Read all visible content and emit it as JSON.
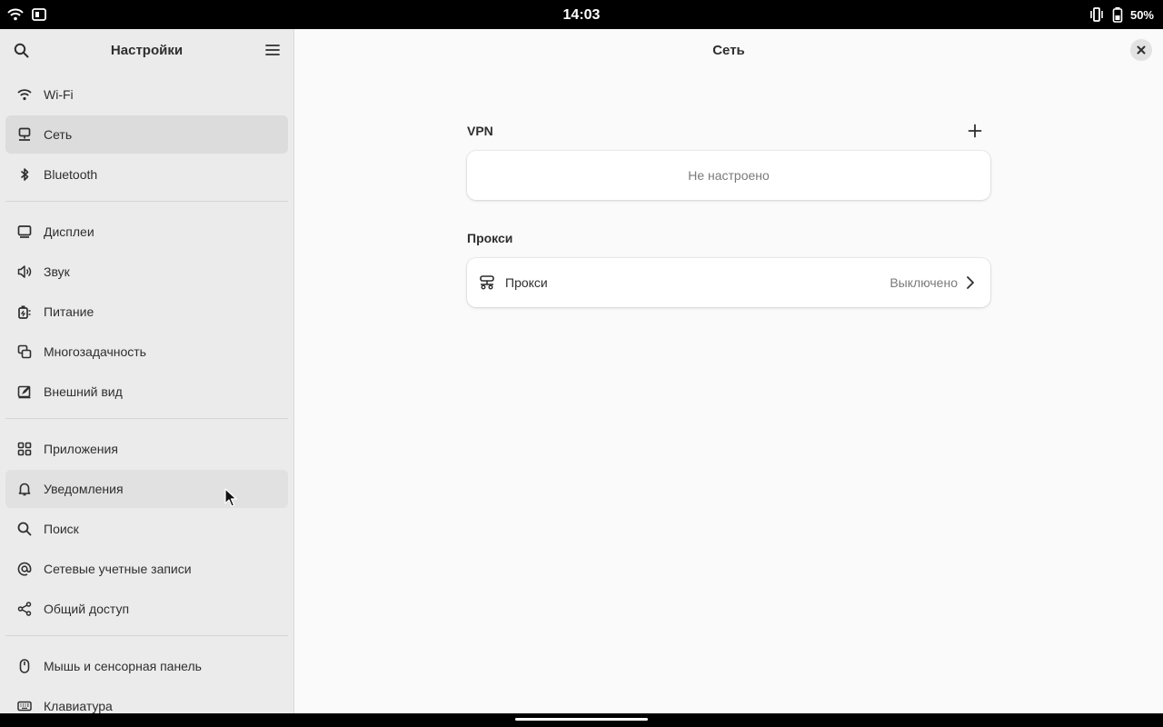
{
  "statusbar": {
    "clock": "14:03",
    "battery_percent": "50%",
    "icons": [
      "wifi-icon",
      "screen-rotate-icon",
      "vibrate-icon",
      "battery-icon"
    ]
  },
  "sidebar": {
    "title": "Настройки",
    "groups": [
      [
        {
          "label": "Wi-Fi",
          "icon": "wifi-icon"
        },
        {
          "label": "Сеть",
          "icon": "network-icon",
          "selected": true
        },
        {
          "label": "Bluetooth",
          "icon": "bluetooth-icon"
        }
      ],
      [
        {
          "label": "Дисплеи",
          "icon": "display-icon"
        },
        {
          "label": "Звук",
          "icon": "sound-icon"
        },
        {
          "label": "Питание",
          "icon": "power-icon"
        },
        {
          "label": "Многозадачность",
          "icon": "multitasking-icon"
        },
        {
          "label": "Внешний вид",
          "icon": "appearance-icon"
        }
      ],
      [
        {
          "label": "Приложения",
          "icon": "apps-icon"
        },
        {
          "label": "Уведомления",
          "icon": "bell-icon",
          "hover": true
        },
        {
          "label": "Поиск",
          "icon": "search-icon"
        },
        {
          "label": "Сетевые учетные записи",
          "icon": "at-icon"
        },
        {
          "label": "Общий доступ",
          "icon": "share-icon"
        }
      ],
      [
        {
          "label": "Мышь и сенсорная панель",
          "icon": "mouse-icon"
        },
        {
          "label": "Клавиатура",
          "icon": "keyboard-icon"
        }
      ]
    ]
  },
  "content": {
    "title": "Сеть",
    "vpn": {
      "title": "VPN",
      "empty_text": "Не настроено"
    },
    "proxy": {
      "title": "Прокси",
      "row_label": "Прокси",
      "row_value": "Выключено"
    }
  },
  "colors": {
    "sidebar_bg": "#ebebeb",
    "content_bg": "#fafafa",
    "selected_bg": "#dcdcdc",
    "text": "#2e2e2e",
    "dim_text": "#7a7a7a"
  }
}
